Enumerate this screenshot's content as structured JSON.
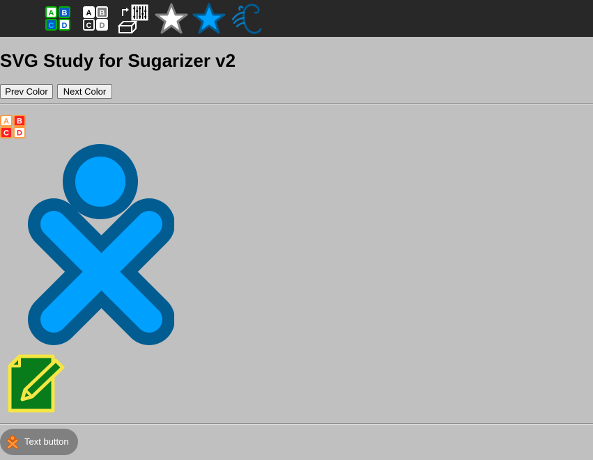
{
  "toolbar": {
    "tools": [
      {
        "name": "abcd-color-icon",
        "letters": [
          "A",
          "B",
          "C",
          "D"
        ]
      },
      {
        "name": "abcd-gray-icon",
        "letters": [
          "A",
          "B",
          "C",
          "D"
        ]
      },
      {
        "name": "abacus-icon"
      },
      {
        "name": "star-white-icon"
      },
      {
        "name": "star-blue-icon"
      },
      {
        "name": "cursive-c-icon"
      }
    ]
  },
  "page": {
    "title": "SVG Study for Sugarizer v2"
  },
  "buttons": {
    "prev_color": "Prev Color",
    "next_color": "Next Color"
  },
  "content": {
    "small_abcd": {
      "letters": [
        "A",
        "B",
        "C",
        "D"
      ]
    },
    "xo_icon": {
      "stroke": "#005c91",
      "fill": "#00a0ff"
    },
    "write_icon": {
      "stroke": "#f5e644",
      "fill": "#087c1a"
    }
  },
  "footer": {
    "text_button_label": "Text button"
  },
  "colors": {
    "toolbar_bg": "#282828",
    "page_bg": "#c0c0c0",
    "xo_stroke": "#005c91",
    "xo_fill": "#00a0ff",
    "text_button_bg": "#808080",
    "footer_xo_stroke": "#e05a00",
    "footer_xo_fill": "#ff9a40"
  }
}
